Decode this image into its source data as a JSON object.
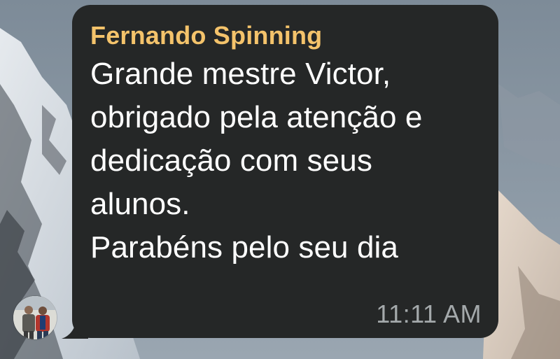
{
  "chat": {
    "message": {
      "sender": "Fernando Spinning",
      "lines": [
        "Grande mestre Victor,",
        "obrigado pela atenção e",
        "dedicação com seus",
        "alunos.",
        "Parabéns pelo seu dia"
      ],
      "time": "11:11 AM"
    },
    "avatar_icon": "contact-avatar-photo",
    "wallpaper": "snowy-mountain"
  },
  "colors": {
    "bubble": "#252727",
    "sender_name": "#f4c36b",
    "message_text": "#ffffff",
    "timestamp": "#a4a9ab"
  }
}
